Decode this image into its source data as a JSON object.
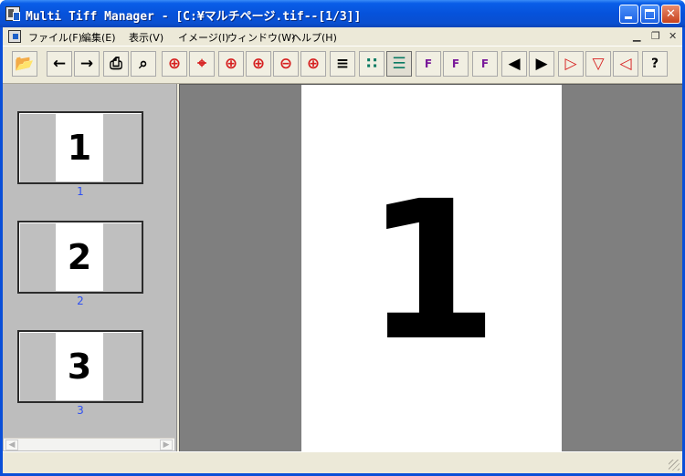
{
  "window": {
    "title": "Multi Tiff Manager - [C:¥マルチページ.tif--[1/3]]"
  },
  "menu": {
    "items": [
      {
        "label": "ファイル(F)"
      },
      {
        "label": "編集(E)"
      },
      {
        "label": "表示(V)"
      },
      {
        "label": "イメージ(I)"
      },
      {
        "label": "ウィンドウ(W)"
      },
      {
        "label": "ヘルプ(H)"
      }
    ]
  },
  "toolbar": {
    "buttons": [
      {
        "icon": "open-folder-icon",
        "glyph": "📂"
      },
      {
        "icon": "arrow-left-icon",
        "glyph": "←"
      },
      {
        "icon": "arrow-right-icon",
        "glyph": "→"
      },
      {
        "icon": "print-icon",
        "glyph": "⎙"
      },
      {
        "icon": "print-preview-icon",
        "glyph": "⌕"
      },
      {
        "icon": "zoom-icon",
        "glyph": "⊕"
      },
      {
        "icon": "zoom-crosshair-icon",
        "glyph": "⌖"
      },
      {
        "icon": "zoom-area-icon",
        "glyph": "⊕"
      },
      {
        "icon": "zoom-in-icon",
        "glyph": "⊕"
      },
      {
        "icon": "zoom-out-icon",
        "glyph": "⊖"
      },
      {
        "icon": "zoom-custom-icon",
        "glyph": "⊕"
      },
      {
        "icon": "fit-page-icon",
        "glyph": "≡"
      },
      {
        "icon": "thumbnail-grid-icon",
        "glyph": "∷"
      },
      {
        "icon": "thumbnail-list-icon",
        "glyph": "☰"
      },
      {
        "icon": "insert-page-icon",
        "glyph": "F"
      },
      {
        "icon": "replace-page-icon",
        "glyph": "F"
      },
      {
        "icon": "append-page-icon",
        "glyph": "F"
      },
      {
        "icon": "prev-page-icon",
        "glyph": "◀"
      },
      {
        "icon": "next-page-icon",
        "glyph": "▶"
      },
      {
        "icon": "rotate-right-icon",
        "glyph": "▷"
      },
      {
        "icon": "flip-vertical-icon",
        "glyph": "▽"
      },
      {
        "icon": "rotate-left-icon",
        "glyph": "◁"
      },
      {
        "icon": "help-icon",
        "glyph": "?"
      }
    ]
  },
  "thumbnails": [
    {
      "number": "1",
      "label": "1"
    },
    {
      "number": "2",
      "label": "2"
    },
    {
      "number": "3",
      "label": "3"
    }
  ],
  "viewer": {
    "page_content": "1"
  },
  "colors": {
    "title_bar": "#0a5ee8",
    "thumb_label": "#2d4ff2",
    "view_background": "#7f7f7f"
  }
}
